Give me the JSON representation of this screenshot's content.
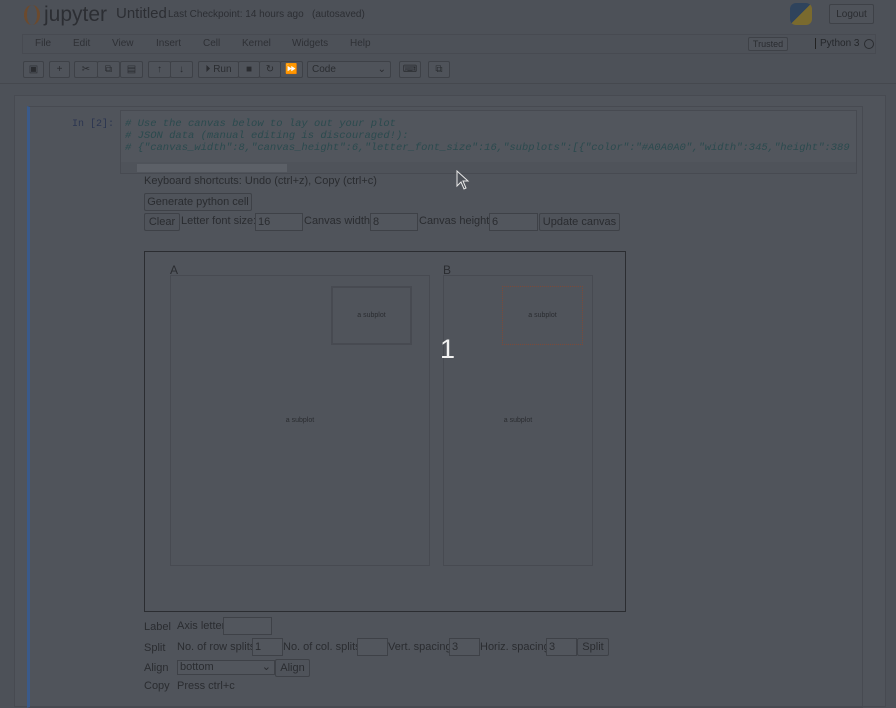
{
  "header": {
    "logo": "jupyter",
    "title": "Untitled",
    "checkpoint": "Last Checkpoint: 14 hours ago",
    "autosaved": "(autosaved)",
    "logout": "Logout"
  },
  "menu": [
    "File",
    "Edit",
    "View",
    "Insert",
    "Cell",
    "Kernel",
    "Widgets",
    "Help"
  ],
  "status": {
    "trusted": "Trusted",
    "kernel": "Python 3"
  },
  "toolbar": {
    "run": "Run",
    "cell_type": "Code"
  },
  "cell": {
    "prompt": "In [2]:",
    "code": [
      "# Use the canvas below to lay out your plot",
      "# JSON data (manual editing is discouraged!):",
      "# {\"canvas_width\":8,\"canvas_height\":6,\"letter_font_size\":16,\"subplots\":[{\"color\":\"#A0A0A0\",\"width\":345,\"height\":389"
    ]
  },
  "widget": {
    "shortcuts": "Keyboard shortcuts: Undo (ctrl+z), Copy (ctrl+c)",
    "generate": "Generate python cell",
    "clear": "Clear",
    "font_size_label": "Letter font size:",
    "font_size": "16",
    "width_label": "Canvas width:",
    "width": "8",
    "height_label": "Canvas height:",
    "height": "6",
    "update": "Update canvas",
    "canvas": {
      "letter_a": "A",
      "letter_b": "B",
      "subplot_label": "a subplot",
      "overlay_number": "1"
    },
    "label_row": {
      "label": "Label",
      "axis_letter": "Axis letter",
      "value": ""
    },
    "split_row": {
      "label": "Split",
      "rows_label": "No. of row splits",
      "rows": "1",
      "cols_label": "No. of col. splits",
      "cols": "",
      "vspace_label": "Vert. spacing",
      "vspace": "3",
      "hspace_label": "Horiz. spacing",
      "hspace": "3",
      "button": "Split"
    },
    "align_row": {
      "label": "Align",
      "value": "bottom",
      "button": "Align"
    },
    "copy_row": {
      "label": "Copy",
      "text": "Press ctrl+c"
    }
  }
}
